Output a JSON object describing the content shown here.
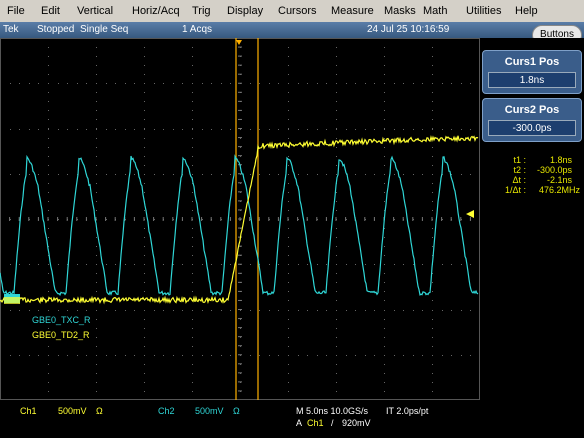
{
  "menu": [
    "File",
    "Edit",
    "Vertical",
    "Horiz/Acq",
    "Trig",
    "Display",
    "Cursors",
    "Measure",
    "Masks",
    "Math",
    "Utilities",
    "Help"
  ],
  "status": {
    "brand": "Tek",
    "state": "Stopped",
    "mode": "Single Seq",
    "acqs": "1 Acqs",
    "timestamp": "24 Jul 25 10:16:59",
    "buttons_label": "Buttons"
  },
  "cursor_panel": {
    "curs1_title": "Curs1 Pos",
    "curs1_value": "1.8ns",
    "curs2_title": "Curs2 Pos",
    "curs2_value": "-300.0ps"
  },
  "readout": {
    "t1_label": "t1 :",
    "t1_value": "1.8ns",
    "t2_label": "t2 :",
    "t2_value": "-300.0ps",
    "dt_label": "Δt :",
    "dt_value": "-2.1ns",
    "inv_label": "1/Δt :",
    "inv_value": "476.2MHz"
  },
  "traces": {
    "ch1_label": "GBE0_TXC_R",
    "ch2_label": "GBE0_TD2_R",
    "ch1_color": "#2fd6d6",
    "ch2_color": "#ffff33"
  },
  "bottom": {
    "ch1": "Ch1",
    "ch1_scale": "500mV",
    "ch1_term": "Ω",
    "ch2": "Ch2",
    "ch2_scale": "500mV",
    "ch2_term": "Ω",
    "timebase": "M 5.0ns 10.0GS/s",
    "it": "IT 2.0ps/pt",
    "trig_prefix": "A",
    "trig_src": "Ch1",
    "trig_slope": "/",
    "trig_level": "920mV"
  }
}
